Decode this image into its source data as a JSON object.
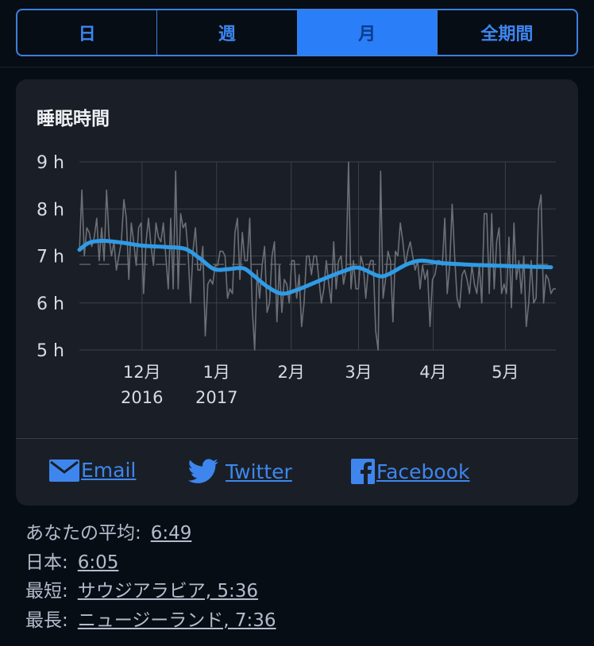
{
  "tabs": [
    {
      "label": "日",
      "active": false
    },
    {
      "label": "週",
      "active": false
    },
    {
      "label": "月",
      "active": true
    },
    {
      "label": "全期間",
      "active": false
    }
  ],
  "colors": {
    "accent": "#2a7ef8",
    "trend_line": "#2f9be6",
    "raw_line": "#6c6f76",
    "grid": "#3a4049",
    "avg_line": "#5a5e66"
  },
  "card": {
    "title": "睡眠時間"
  },
  "share": {
    "email": {
      "label": "Email",
      "icon": "envelope-icon"
    },
    "twitter": {
      "label": "Twitter",
      "icon": "twitter-bird-icon"
    },
    "facebook": {
      "label": "Facebook",
      "icon": "facebook-icon"
    }
  },
  "stats": [
    {
      "label": "あなたの平均:",
      "value": "6:49"
    },
    {
      "label": "日本:",
      "value": "6:05"
    },
    {
      "label": "最短:",
      "value": "サウジアラビア, 5:36"
    },
    {
      "label": "最長:",
      "value": "ニュージーランド, 7:36"
    }
  ],
  "chart_data": {
    "type": "line",
    "title": "睡眠時間",
    "xlabel": "",
    "ylabel": "",
    "ylim": [
      5,
      9
    ],
    "yticks": [
      {
        "value": 9,
        "label": "9 h"
      },
      {
        "value": 8,
        "label": "8 h"
      },
      {
        "value": 7,
        "label": "7 h"
      },
      {
        "value": 6,
        "label": "6 h"
      },
      {
        "value": 5,
        "label": "5 h"
      }
    ],
    "xlim_days": [
      0,
      198
    ],
    "xticks": [
      {
        "day": 26,
        "label": "12月",
        "sublabel": "2016"
      },
      {
        "day": 57,
        "label": "1月",
        "sublabel": "2017"
      },
      {
        "day": 88,
        "label": "2月",
        "sublabel": ""
      },
      {
        "day": 116,
        "label": "3月",
        "sublabel": ""
      },
      {
        "day": 147,
        "label": "4月",
        "sublabel": ""
      },
      {
        "day": 177,
        "label": "5月",
        "sublabel": ""
      }
    ],
    "grid": true,
    "legend": "none",
    "average_hours": 6.82,
    "series": [
      {
        "name": "daily",
        "style": "thin-gray",
        "values": [
          7.1,
          8.4,
          7.0,
          7.6,
          7.5,
          7.2,
          7.4,
          7.8,
          6.9,
          7.6,
          6.9,
          8.4,
          7.4,
          7.0,
          7.3,
          6.7,
          7.0,
          7.3,
          8.2,
          7.8,
          6.5,
          7.7,
          7.3,
          6.8,
          7.6,
          7.7,
          6.2,
          7.3,
          7.8,
          7.2,
          6.8,
          7.7,
          7.4,
          7.3,
          7.7,
          7.0,
          6.3,
          7.8,
          6.3,
          8.8,
          6.3,
          7.9,
          7.6,
          7.7,
          7.1,
          6.0,
          7.1,
          7.6,
          6.7,
          6.7,
          7.2,
          5.3,
          6.4,
          6.5,
          6.4,
          6.8,
          6.8,
          7.1,
          7.1,
          7.0,
          6.1,
          6.3,
          6.2,
          7.5,
          7.8,
          6.5,
          7.5,
          6.9,
          6.9,
          7.8,
          5.9,
          4.9,
          6.7,
          6.1,
          6.8,
          7.2,
          5.8,
          6.0,
          7.0,
          7.3,
          5.6,
          6.8,
          5.8,
          6.5,
          6.4,
          6.0,
          6.9,
          6.9,
          6.1,
          6.6,
          5.5,
          6.0,
          7.0,
          7.0,
          6.6,
          7.0,
          7.0,
          6.5,
          6.0,
          6.3,
          6.9,
          6.4,
          6.0,
          7.3,
          6.3,
          6.9,
          7.0,
          6.4,
          6.7,
          9.0,
          6.3,
          6.9,
          6.3,
          6.3,
          7.0,
          6.8,
          6.1,
          6.7,
          6.9,
          6.9,
          5.4,
          4.9,
          8.8,
          6.1,
          6.5,
          7.1,
          6.9,
          5.6,
          7.1,
          7.0,
          7.7,
          7.3,
          6.8,
          7.1,
          7.3,
          7.0,
          6.7,
          6.9,
          6.3,
          6.8,
          6.5,
          6.7,
          5.5,
          6.5,
          6.6,
          6.9,
          6.9,
          6.8,
          7.8,
          6.2,
          6.8,
          8.1,
          7.0,
          6.1,
          5.9,
          6.6,
          6.7,
          6.5,
          6.2,
          6.8,
          6.4,
          6.2,
          6.8,
          6.0,
          7.9,
          7.9,
          6.2,
          7.9,
          6.3,
          7.3,
          7.6,
          6.2,
          6.4,
          6.2,
          7.4,
          5.9,
          7.7,
          6.5,
          6.9,
          6.2,
          7.0,
          5.5,
          6.0,
          6.9,
          6.0,
          6.1,
          8.0,
          8.3,
          6.0,
          6.6,
          6.5,
          6.2,
          6.3,
          6.3
        ]
      },
      {
        "name": "trend",
        "style": "thick-blue",
        "points": [
          [
            0,
            7.13
          ],
          [
            4,
            7.28
          ],
          [
            10,
            7.32
          ],
          [
            18,
            7.28
          ],
          [
            26,
            7.22
          ],
          [
            36,
            7.19
          ],
          [
            44,
            7.15
          ],
          [
            50,
            6.95
          ],
          [
            56,
            6.72
          ],
          [
            62,
            6.72
          ],
          [
            68,
            6.74
          ],
          [
            72,
            6.6
          ],
          [
            78,
            6.35
          ],
          [
            84,
            6.2
          ],
          [
            90,
            6.27
          ],
          [
            100,
            6.48
          ],
          [
            110,
            6.68
          ],
          [
            116,
            6.75
          ],
          [
            124,
            6.58
          ],
          [
            128,
            6.6
          ],
          [
            136,
            6.82
          ],
          [
            142,
            6.9
          ],
          [
            150,
            6.85
          ],
          [
            160,
            6.82
          ],
          [
            170,
            6.8
          ],
          [
            180,
            6.78
          ],
          [
            188,
            6.77
          ],
          [
            196,
            6.76
          ]
        ]
      }
    ]
  }
}
